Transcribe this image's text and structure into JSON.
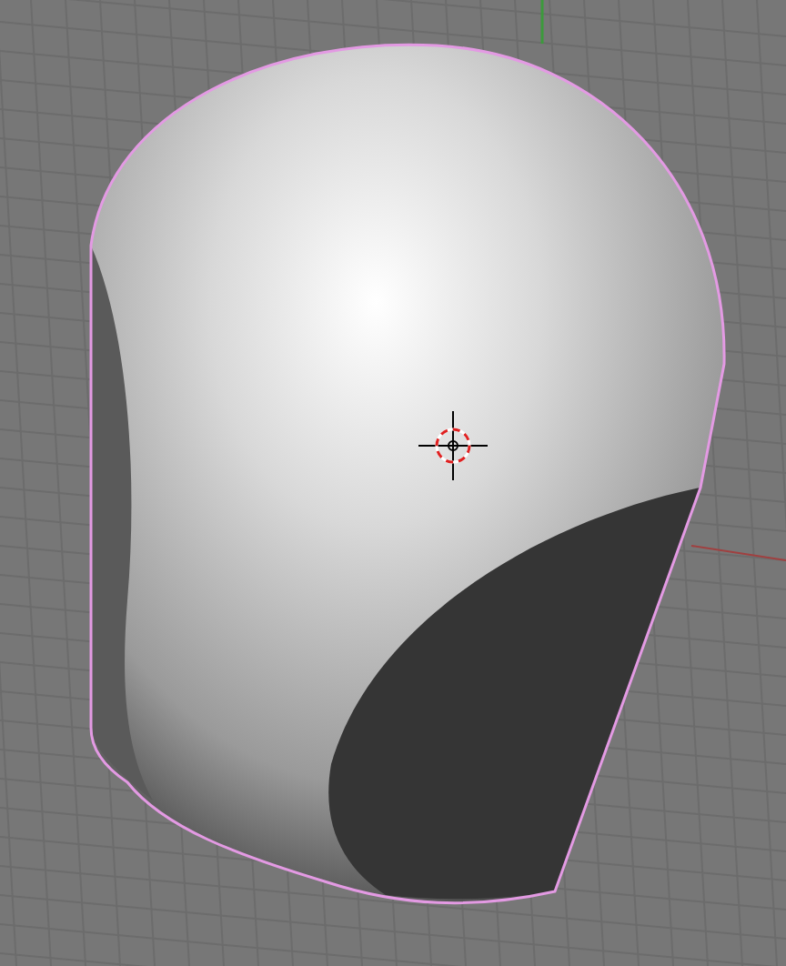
{
  "viewport": {
    "grid": true,
    "object_selected": true
  }
}
